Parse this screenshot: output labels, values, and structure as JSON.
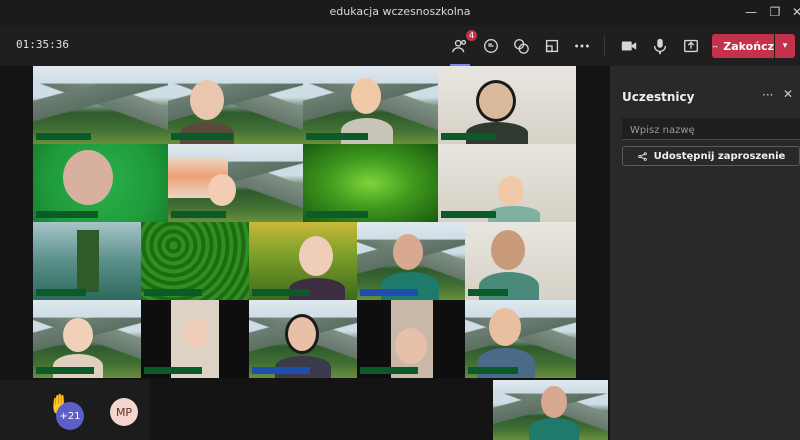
{
  "window": {
    "title": "edukacja wczesnoszkolna",
    "controls": [
      "minimize-icon",
      "restore-icon",
      "close-icon"
    ]
  },
  "toolbar": {
    "timer": "01:35:36",
    "participants_badge": "4",
    "end_label": "Zakończ",
    "icons": [
      "people-icon",
      "chat-icon",
      "reactions-icon",
      "rooms-icon",
      "more-icon",
      "camera-icon",
      "mic-icon",
      "share-icon",
      "phone-icon"
    ]
  },
  "bottom": {
    "raised_count": "+21",
    "avatar_initials": "MP"
  },
  "panel": {
    "title": "Uczestnicy",
    "search_placeholder": "Wpisz nazwę",
    "share_label": "Udostępnij zaproszenie"
  },
  "colors": {
    "accent": "#7f85f5",
    "end_button": "#c4314b",
    "avatar_purple": "#5b5fc7",
    "name_tag_green": "#0b5a2a"
  }
}
